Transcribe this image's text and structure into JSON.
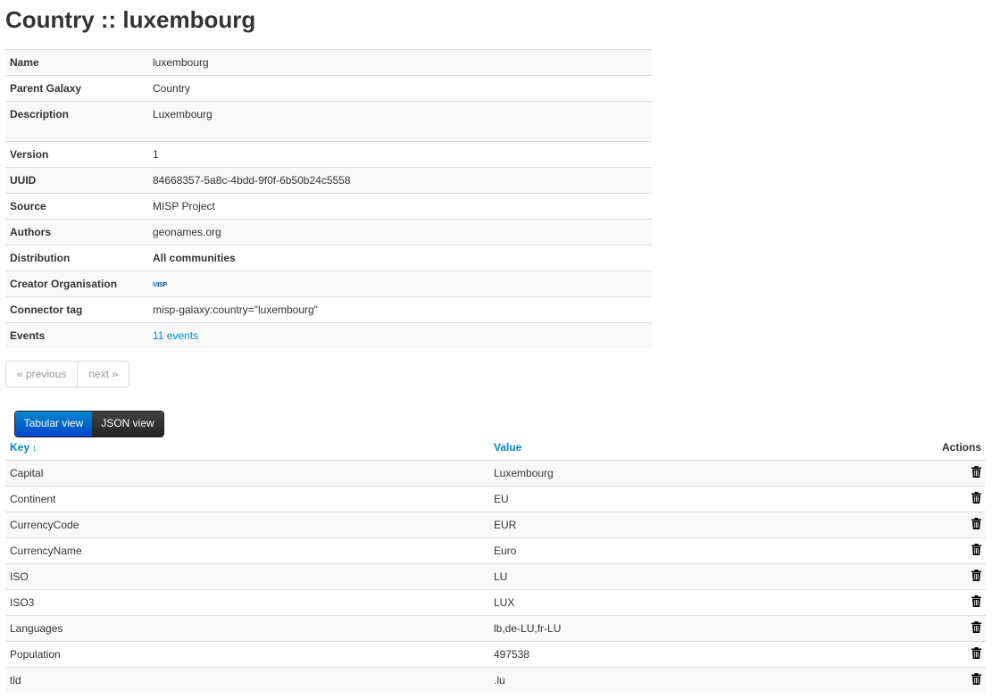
{
  "page": {
    "title": "Country :: luxembourg"
  },
  "meta": [
    {
      "key": "Name",
      "value": "luxembourg"
    },
    {
      "key": "Parent Galaxy",
      "value": "Country"
    },
    {
      "key": "Description",
      "value": "Luxembourg"
    },
    {
      "key": "Version",
      "value": "1"
    },
    {
      "key": "UUID",
      "value": "84668357-5a8c-4bdd-9f0f-6b50b24c5558"
    },
    {
      "key": "Source",
      "value": "MISP Project"
    },
    {
      "key": "Authors",
      "value": "geonames.org"
    },
    {
      "key": "Distribution",
      "value": "All communities"
    },
    {
      "key": "Creator Organisation",
      "value": "MISP",
      "icon": "misp-org-logo"
    },
    {
      "key": "Connector tag",
      "value": "misp-galaxy:country=\"luxembourg\""
    },
    {
      "key": "Events",
      "value": "11 events"
    }
  ],
  "pagination": {
    "previous": "« previous",
    "next": "next »"
  },
  "view_toggle": {
    "tabular": "Tabular view",
    "json": "JSON view",
    "active": "tabular"
  },
  "table": {
    "headers": {
      "key": "Key",
      "value": "Value",
      "actions": "Actions"
    },
    "sort_icon": "sort-down-icon",
    "rows": [
      {
        "key": "Capital",
        "value": "Luxembourg"
      },
      {
        "key": "Continent",
        "value": "EU"
      },
      {
        "key": "CurrencyCode",
        "value": "EUR"
      },
      {
        "key": "CurrencyName",
        "value": "Euro"
      },
      {
        "key": "ISO",
        "value": "LU"
      },
      {
        "key": "ISO3",
        "value": "LUX"
      },
      {
        "key": "Languages",
        "value": "lb,de-LU,fr-LU"
      },
      {
        "key": "Population",
        "value": "497538"
      },
      {
        "key": "tld",
        "value": ".lu"
      }
    ]
  },
  "colors": {
    "link": "#0088cc",
    "primary": "#0044cc",
    "dark": "#222222",
    "stripe": "#f9f9f9"
  }
}
